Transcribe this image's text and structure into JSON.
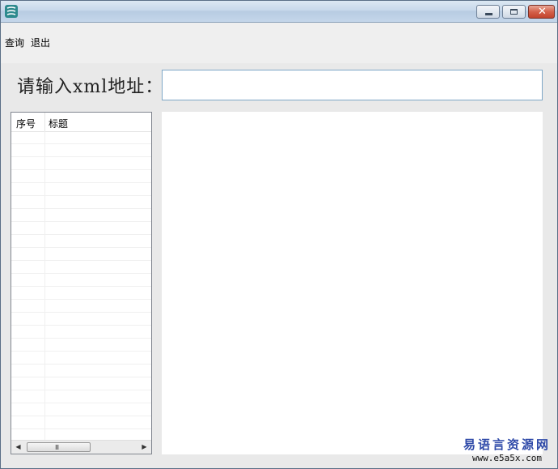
{
  "menu": {
    "query_label": "查询",
    "exit_label": "退出"
  },
  "form": {
    "url_label": "请输入xml地址：",
    "url_value": "",
    "url_placeholder": ""
  },
  "list": {
    "columns": [
      "序号",
      "标题"
    ],
    "scroll_grip": "III"
  },
  "watermark": {
    "title": "易语言资源网",
    "url": "www.e5a5x.com"
  },
  "colors": {
    "titlebar": "#c7d8ea",
    "close_button": "#c2432c",
    "input_border": "#7ea7c7",
    "watermark_blue": "#2e49a8"
  },
  "icons": {
    "app": "app-icon",
    "minimize": "minimize-icon",
    "maximize": "maximize-icon",
    "close": "close-icon"
  }
}
